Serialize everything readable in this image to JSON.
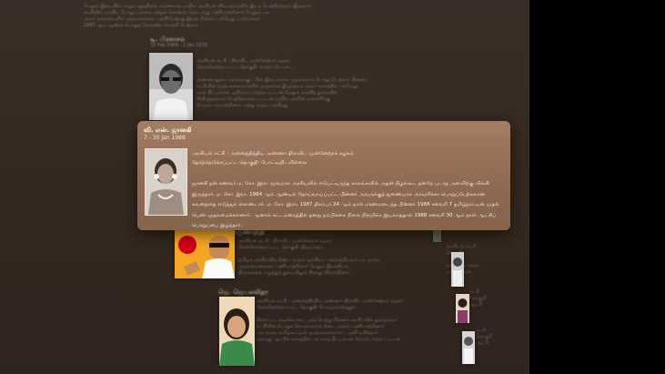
{
  "popup": {
    "name": "வி. என். ஜானகி",
    "dates": "7 - 30 Jan 1988",
    "party_line": "அரசியல் கட்சி : அனைத்திந்திய அண்ணா திராவிட முன்னேற்றக் கழகம்",
    "election_line": "தேர்ந்தெடுக்கப்பட்ட தொகுதி: போட்டியிடவில்லை",
    "description": "ஜானகி தன் கணவர் ம. கோ. இரா. மூலமாக அரசியலில் ஈடுபட்டிருந்த காலங்களில் அதன் நிழல்கூட நன்றே படாத அளவிற்கு விலகி இருந்தார். ம. கோ. இரா. 1984 ஆம் ஆண்டில் நோய்வாய்ப்பட்ட பின்னர் அவருக்குத் துணையாக அமெரிக்கா பொறுப்பேற்கலான கவனத்தை எடுத்துக் கொண்டார். ம. கோ. இரா. 1987 திசம்பர் 24 ஆம் நாள் மரணமடைந்த பின்னர் 1988 சனவரி 7 தமிழ்நாட்டின் முதல் பெண் முதலமைச்சரானார். ஆனால் சட்டமன்றத்தில் தனது நம்பிக்கை நிலை நிரூபிக்க இயலாததால் 1988 சனவரி 30 ஆம் நாள் ஆட்சிப் பொறுப்பை இழந்தார்."
  },
  "timeline": {
    "top_entry_title": "டி. பிரகாசம்",
    "top_entry_dates": "10 Feb 1969 - 1 Jan 1976",
    "mid_entry_title": "மு. கருணாநிதி",
    "lower_entry_title": "ஜெ. ஜெயலலிதா"
  }
}
